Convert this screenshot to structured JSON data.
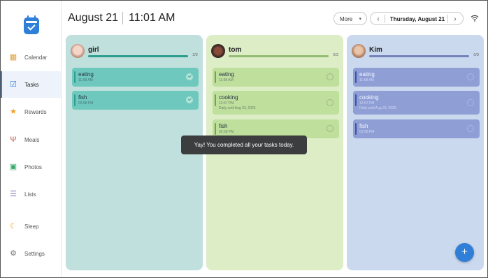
{
  "header": {
    "date": "August 21",
    "time": "11:01 AM",
    "more_label": "More",
    "day_label": "Thursday, August 21"
  },
  "sidebar": {
    "items": [
      {
        "label": "Calendar",
        "icon": "calendar-icon",
        "active": false
      },
      {
        "label": "Tasks",
        "icon": "tasks-checkbox-icon",
        "active": true
      },
      {
        "label": "Rewards",
        "icon": "star-icon",
        "active": false
      },
      {
        "label": "Meals",
        "icon": "fork-knife-icon",
        "active": false
      },
      {
        "label": "Photos",
        "icon": "photo-icon",
        "active": false
      },
      {
        "label": "Lists",
        "icon": "list-icon",
        "active": false
      },
      {
        "label": "Sleep",
        "icon": "moon-icon",
        "active": false
      },
      {
        "label": "Settings",
        "icon": "gear-icon",
        "active": false
      }
    ]
  },
  "columns": [
    {
      "name": "girl",
      "count": "2/2",
      "progress": 1.0,
      "accent": "#2e9d8f",
      "tasks": [
        {
          "title": "eating",
          "time": "11:58 AM",
          "done": true
        },
        {
          "title": "fish",
          "time": "02:58 PM",
          "done": true
        }
      ]
    },
    {
      "name": "tom",
      "count": "0/3",
      "progress": 0.0,
      "accent": "#6ea83f",
      "tasks": [
        {
          "title": "eating",
          "time": "11:58 AM",
          "done": false
        },
        {
          "title": "cooking",
          "time": "12:57 PM",
          "repeat": "Daily until Aug 23, 2025",
          "done": false
        },
        {
          "title": "fish",
          "time": "02:58 PM",
          "done": false
        }
      ]
    },
    {
      "name": "Kim",
      "count": "0/3",
      "progress": 0.0,
      "accent": "#3f51a8",
      "tasks": [
        {
          "title": "eating",
          "time": "11:58 AM",
          "done": false
        },
        {
          "title": "cooking",
          "time": "12:57 PM",
          "repeat": "Daily until Aug 23, 2025",
          "done": false
        },
        {
          "title": "fish",
          "time": "02:58 PM",
          "done": false
        }
      ]
    }
  ],
  "toast": "Yay! You completed all your tasks today.",
  "fab_label": "+"
}
